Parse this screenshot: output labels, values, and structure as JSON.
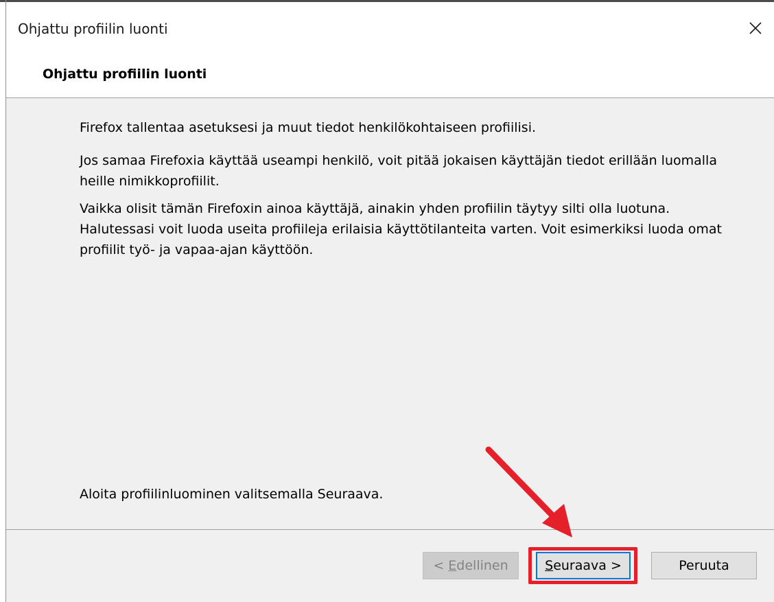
{
  "window": {
    "title": "Ohjattu profiilin luonti"
  },
  "header": {
    "title": "Ohjattu profiilin luonti"
  },
  "content": {
    "paragraphs": [
      "Firefox tallentaa asetuksesi ja muut tiedot henkilökohtaiseen profiilisi.",
      "Jos samaa Firefoxia käyttää useampi henkilö, voit pitää jokaisen käyttäjän tiedot erillään luomalla heille nimikkoprofiilit.",
      "Vaikka olisit tämän Firefoxin ainoa käyttäjä, ainakin yhden profiilin täytyy silti olla luotuna. Halutessasi voit luoda useita profiileja erilaisia käyttötilanteita varten. Voit esimerkiksi luoda omat profiilit työ- ja vapaa-ajan käyttöön."
    ],
    "instruction": "Aloita profiilinluominen valitsemalla Seuraava."
  },
  "buttons": {
    "back": {
      "prefix": "< ",
      "mnemonic": "E",
      "rest": "dellinen",
      "enabled": false
    },
    "next": {
      "mnemonic": "S",
      "rest": "euraava >",
      "enabled": true
    },
    "cancel": {
      "label": "Peruuta",
      "enabled": true
    }
  },
  "icons": {
    "close": "close-icon"
  },
  "annotation": {
    "color": "#e4202a"
  }
}
